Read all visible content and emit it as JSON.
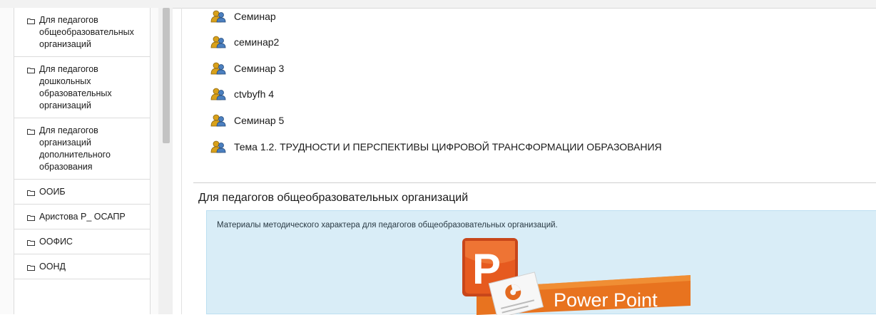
{
  "sidebar": {
    "items": [
      {
        "label": "Для педагогов общеобразовательных организаций",
        "lines": [
          "Для педагогов",
          "общеобразовательных",
          "организаций"
        ]
      },
      {
        "label": "Для педагогов дошкольных образовательных организаций",
        "lines": [
          "Для педагогов",
          "дошкольных",
          "образовательных",
          "организаций"
        ]
      },
      {
        "label": "Для педагогов организаций дополнительного образования",
        "lines": [
          "Для педагогов",
          "организаций",
          "дополнительного",
          "образования"
        ]
      },
      {
        "label": "ООИБ",
        "lines": [
          "ООИБ"
        ]
      },
      {
        "label": "Аристова Р_ ОСАПР",
        "lines": [
          "Аристова Р_ ОСАПР"
        ]
      },
      {
        "label": "ООФИС",
        "lines": [
          "ООФИС"
        ]
      },
      {
        "label": "ООНД",
        "lines": [
          "ООНД"
        ]
      }
    ]
  },
  "main": {
    "activities": [
      {
        "label": "Семинар",
        "icon": "seminar-users-icon"
      },
      {
        "label": "семинар2",
        "icon": "seminar-users-icon"
      },
      {
        "label": "Семинар 3",
        "icon": "seminar-users-icon"
      },
      {
        "label": "ctvbyfh 4",
        "icon": "seminar-users-icon"
      },
      {
        "label": "Семинар 5",
        "icon": "seminar-users-icon"
      },
      {
        "label": "Тема 1.2. ТРУДНОСТИ И ПЕРСПЕКТИВЫ ЦИФРОВОЙ ТРАНСФОРМАЦИИ ОБРАЗОВАНИЯ",
        "icon": "seminar-users-icon"
      }
    ],
    "section": {
      "title": "Для педагогов общеобразовательных организаций",
      "summary": "Материалы методического характера для педагогов общеобразовательных организаций.",
      "image_caption": "Power Point"
    }
  },
  "colors": {
    "summary_bg": "#d9edf7",
    "ppt_orange": "#e8731f",
    "ppt_dark": "#b83b12",
    "icon_gold": "#d9a11a",
    "icon_blue": "#4b7fbf"
  }
}
